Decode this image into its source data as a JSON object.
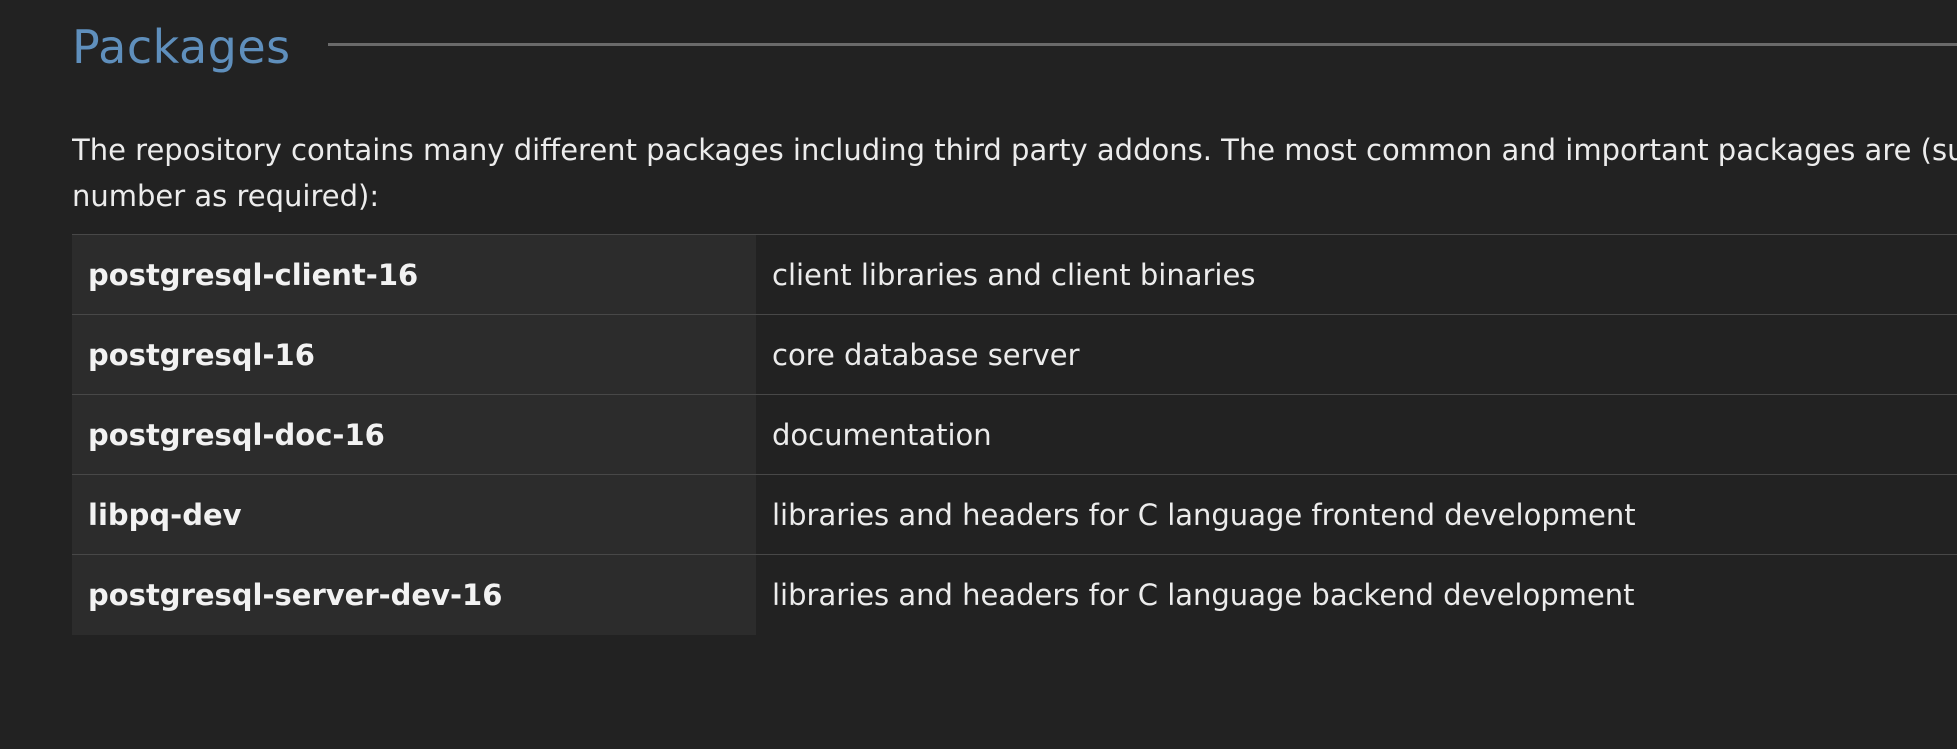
{
  "section": {
    "title": "Packages",
    "intro_lines": [
      "The repository contains many different packages including third party addons. The most common and important packages are (subs",
      "number as required):"
    ]
  },
  "packages": [
    {
      "name": "postgresql-client-16",
      "description": "client libraries and client binaries"
    },
    {
      "name": "postgresql-16",
      "description": "core database server"
    },
    {
      "name": "postgresql-doc-16",
      "description": "documentation"
    },
    {
      "name": "libpq-dev",
      "description": "libraries and headers for C language frontend development"
    },
    {
      "name": "postgresql-server-dev-16",
      "description": "libraries and headers for C language backend development"
    }
  ],
  "colors": {
    "background": "#222222",
    "heading": "#5f8fbc",
    "text": "#ececec",
    "name_cell_bg": "#2c2c2c",
    "rule": "#6a6a6a"
  }
}
